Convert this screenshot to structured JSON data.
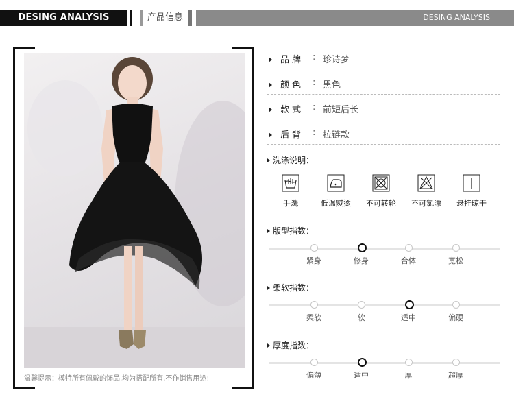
{
  "header": {
    "left_title": "DESING ANALYSIS",
    "mid_title": "产品信息",
    "right_title": "DESING ANALYSIS"
  },
  "photo": {
    "disclaimer": "温馨提示：模特所有佩戴的饰品,均为搭配所有,不作销售用途!"
  },
  "info": [
    {
      "label": "品牌",
      "colon": ":",
      "value": "珍诗梦"
    },
    {
      "label": "颜色",
      "colon": ":",
      "value": "黑色"
    },
    {
      "label": "款式",
      "colon": ":",
      "value": "前短后长"
    },
    {
      "label": "后背",
      "colon": ":",
      "value": "拉链款"
    }
  ],
  "care": {
    "title": "洗涤说明：",
    "items": [
      {
        "icon": "hand-wash-icon",
        "label": "手洗"
      },
      {
        "icon": "low-temp-iron-icon",
        "label": "低温熨烫"
      },
      {
        "icon": "no-tumble-dry-icon",
        "label": "不可转轮"
      },
      {
        "icon": "no-bleach-icon",
        "label": "不可氯漂"
      },
      {
        "icon": "hang-dry-icon",
        "label": "悬挂晾干"
      }
    ]
  },
  "scales": [
    {
      "title": "版型指数：",
      "options": [
        "紧身",
        "修身",
        "合体",
        "宽松"
      ],
      "selected": "修身"
    },
    {
      "title": "柔软指数：",
      "options": [
        "柔软",
        "软",
        "适中",
        "偏硬"
      ],
      "selected": "适中"
    },
    {
      "title": "厚度指数：",
      "options": [
        "偏薄",
        "适中",
        "厚",
        "超厚"
      ],
      "selected": "适中"
    }
  ],
  "colors": {
    "accent": "#111111",
    "header_gray": "#8a8a8a",
    "divider": "#bbbbbb"
  }
}
